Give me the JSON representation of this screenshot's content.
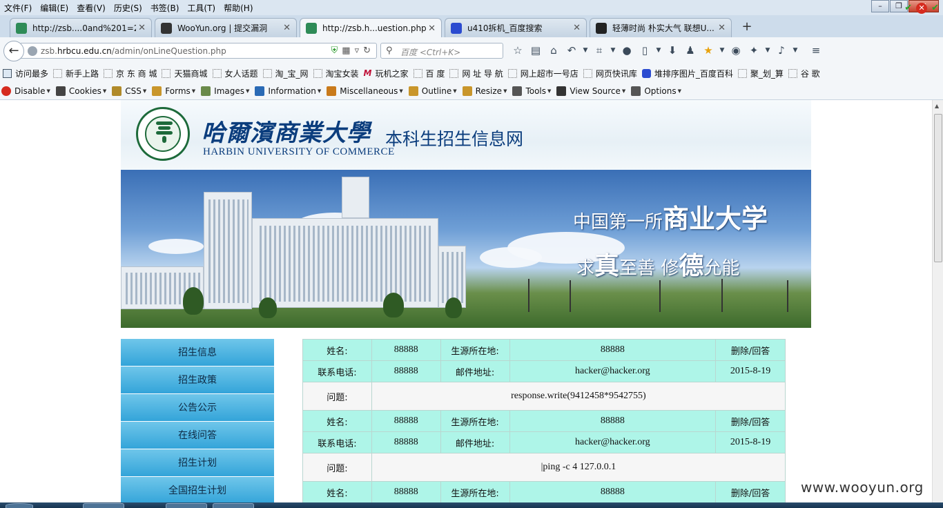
{
  "menu": [
    "文件(F)",
    "编辑(E)",
    "查看(V)",
    "历史(S)",
    "书签(B)",
    "工具(T)",
    "帮助(H)"
  ],
  "window_controls": {
    "minimize": "–",
    "maximize": "❐",
    "close": "✕"
  },
  "tabs": [
    {
      "label": "http://zsb....0and%201=2",
      "favicon_color": "#2e8b57"
    },
    {
      "label": "WooYun.org | 提交漏洞",
      "favicon_color": "#333333"
    },
    {
      "label": "http://zsb.h...uestion.php",
      "favicon_color": "#2e8b57",
      "active": true
    },
    {
      "label": "u410拆机_百度搜索",
      "favicon_color": "#2b4bd0"
    },
    {
      "label": "轻薄时尚 朴实大气 联想U...",
      "favicon_color": "#222222"
    }
  ],
  "new_tab": "+",
  "address": {
    "prefix": "zsb.",
    "host": "hrbcu.edu.cn",
    "path": "/admin/onLineQuestion.php"
  },
  "search": {
    "placeholder": "百度 <Ctrl+K>"
  },
  "bookmarks": [
    "访问最多",
    "新手上路",
    "京 东 商 城",
    "天猫商城",
    "女人话题",
    "淘_宝_网",
    "淘宝女装",
    "玩机之家",
    "百 度",
    "网 址 导 航",
    "网上超市一号店",
    "网页快讯库",
    "堆排序图片_百度百科",
    "聚_划_算",
    "谷 歌"
  ],
  "devbar": [
    {
      "label": "Disable",
      "color": "#d62b1f"
    },
    {
      "label": "Cookies",
      "color": "#444444"
    },
    {
      "label": "CSS",
      "color": "#b08a2a"
    },
    {
      "label": "Forms",
      "color": "#c9962b"
    },
    {
      "label": "Images",
      "color": "#6a8a4a"
    },
    {
      "label": "Information",
      "color": "#2a6ab5"
    },
    {
      "label": "Miscellaneous",
      "color": "#c97a1b"
    },
    {
      "label": "Outline",
      "color": "#c9962b"
    },
    {
      "label": "Resize",
      "color": "#c9962b"
    },
    {
      "label": "Tools",
      "color": "#555555"
    },
    {
      "label": "View Source",
      "color": "#333333"
    },
    {
      "label": "Options",
      "color": "#555555"
    }
  ],
  "site": {
    "name_cn": "哈爾濱商業大學",
    "name_en": "HARBIN UNIVERSITY OF COMMERCE",
    "subtitle": "本科生招生信息网",
    "seal_text": "HARBIN UNIVERSITY OF COMMERCE · 1952",
    "banner_line1_small": "中国第一所",
    "banner_line1_big": "商业大学",
    "banner_line2": [
      {
        "text": "求",
        "big": false
      },
      {
        "text": "真",
        "big": true
      },
      {
        "text": "至善 ",
        "big": false
      },
      {
        "text": "修",
        "big": false
      },
      {
        "text": "德",
        "big": true
      },
      {
        "text": "允能",
        "big": false
      }
    ]
  },
  "sidebar": [
    "招生信息",
    "招生政策",
    "公告公示",
    "在线问答",
    "招生计划",
    "全国招生计划"
  ],
  "questions": {
    "labels": {
      "name": "姓名:",
      "origin": "生源所在地:",
      "action": "删除/回答",
      "phone": "联系电话:",
      "email": "邮件地址:",
      "question": "问题:"
    },
    "entries": [
      {
        "name": "88888",
        "origin": "88888",
        "phone": "88888",
        "email": "hacker@hacker.org",
        "date": "2015-8-19",
        "question": "response.write(9412458*9542755)"
      },
      {
        "name": "88888",
        "origin": "88888",
        "phone": "88888",
        "email": "hacker@hacker.org",
        "date": "2015-8-19",
        "question": "|ping -c 4 127.0.0.1"
      },
      {
        "name": "88888",
        "origin": "88888"
      }
    ]
  },
  "watermark": "www.wooyun.org"
}
